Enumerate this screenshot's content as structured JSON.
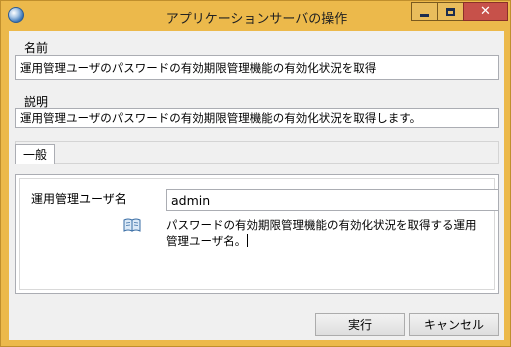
{
  "window": {
    "title": "アプリケーションサーバの操作"
  },
  "name_section": {
    "label": "名前",
    "value": "運用管理ユーザのパスワードの有効期限管理機能の有効化状況を取得"
  },
  "desc_section": {
    "label": "説明",
    "value": "運用管理ユーザのパスワードの有効期限管理機能の有効化状況を取得します。"
  },
  "tabs": [
    {
      "label": "一般",
      "selected": true
    }
  ],
  "general": {
    "param_label": "運用管理ユーザ名",
    "param_value": "admin",
    "help_line1": "パスワードの有効期限管理機能の有効化状況を取得する運用",
    "help_line2": "管理ユーザ名。"
  },
  "buttons": {
    "run": "実行",
    "cancel": "キャンセル"
  }
}
